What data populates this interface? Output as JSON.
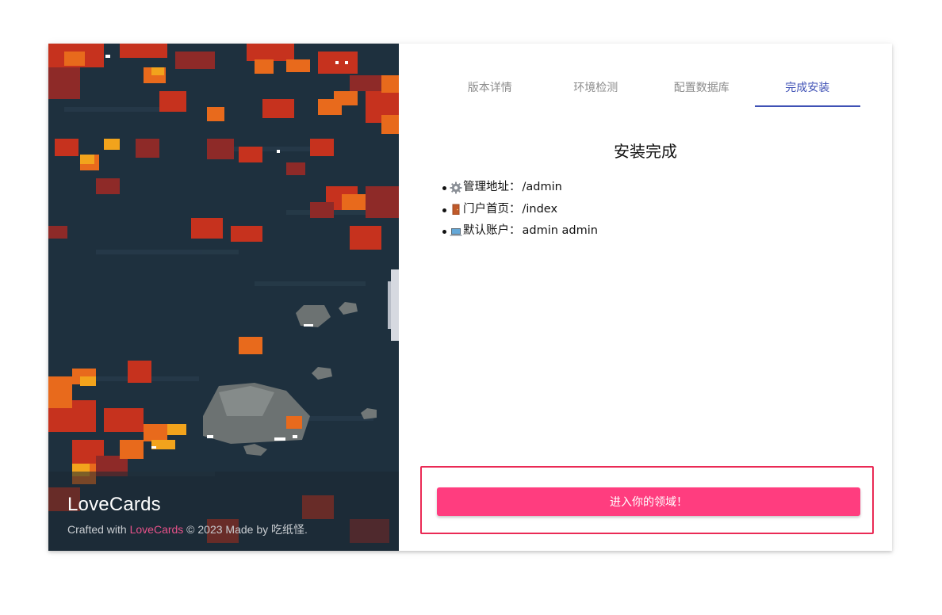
{
  "brand": {
    "name": "LoveCards",
    "credits_prefix": "Crafted with ",
    "credits_link": "LoveCards",
    "credits_suffix": " © 2023 Made by 吃纸怪."
  },
  "tabs": [
    {
      "label": "版本详情",
      "active": false
    },
    {
      "label": "环境检测",
      "active": false
    },
    {
      "label": "配置数据库",
      "active": false
    },
    {
      "label": "完成安装",
      "active": true
    }
  ],
  "main": {
    "title": "安装完成",
    "items": [
      {
        "icon": "gear-icon",
        "label": "管理地址：",
        "value": "/admin"
      },
      {
        "icon": "door-icon",
        "label": "门户首页：",
        "value": "/index"
      },
      {
        "icon": "laptop-icon",
        "label": "默认账户：",
        "value": "admin admin"
      }
    ],
    "enter_button": "进入你的领域！"
  },
  "colors": {
    "accent_tab": "#3f51b5",
    "button": "#ff3d7f",
    "highlight_border": "#ea2a55",
    "credits_link": "#e8528a"
  }
}
